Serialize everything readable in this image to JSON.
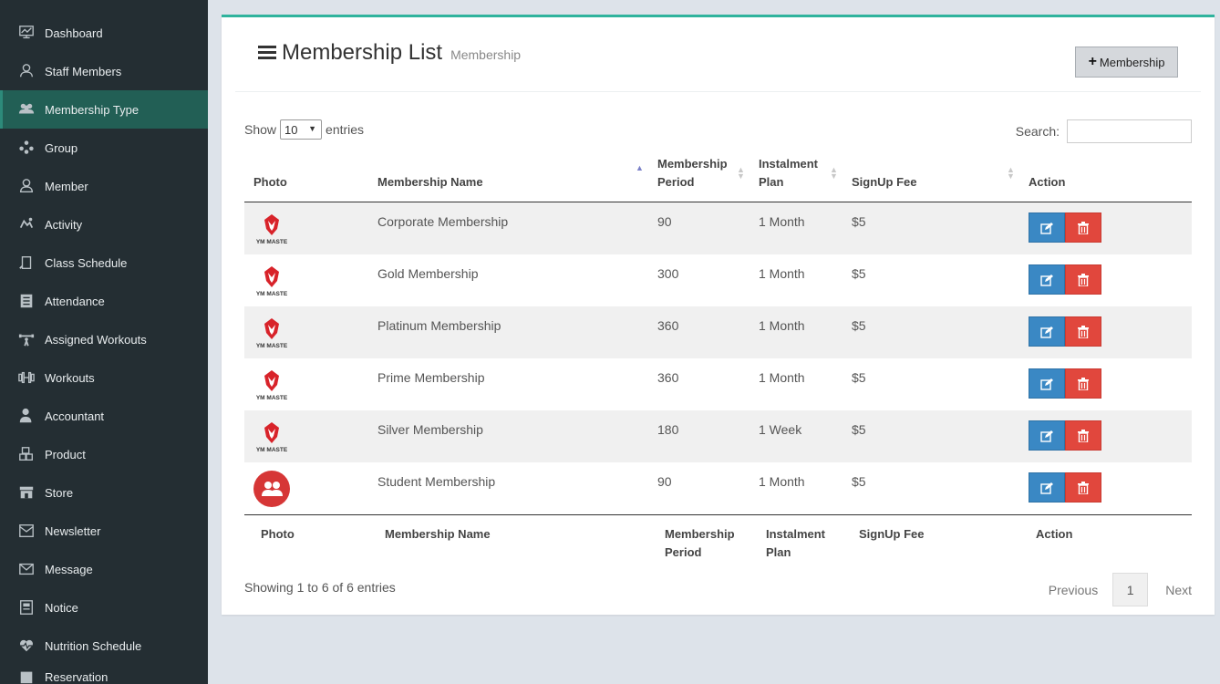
{
  "sidebar": {
    "items": [
      {
        "label": "Dashboard",
        "icon": "dashboard-icon"
      },
      {
        "label": "Staff Members",
        "icon": "staff-icon"
      },
      {
        "label": "Membership Type",
        "icon": "membership-type-icon",
        "active": true
      },
      {
        "label": "Group",
        "icon": "group-icon"
      },
      {
        "label": "Member",
        "icon": "member-icon"
      },
      {
        "label": "Activity",
        "icon": "activity-icon"
      },
      {
        "label": "Class Schedule",
        "icon": "class-schedule-icon"
      },
      {
        "label": "Attendance",
        "icon": "attendance-icon"
      },
      {
        "label": "Assigned Workouts",
        "icon": "assigned-workouts-icon"
      },
      {
        "label": "Workouts",
        "icon": "workouts-icon"
      },
      {
        "label": "Accountant",
        "icon": "accountant-icon"
      },
      {
        "label": "Product",
        "icon": "product-icon"
      },
      {
        "label": "Store",
        "icon": "store-icon"
      },
      {
        "label": "Newsletter",
        "icon": "newsletter-icon"
      },
      {
        "label": "Message",
        "icon": "message-icon"
      },
      {
        "label": "Notice",
        "icon": "notice-icon"
      },
      {
        "label": "Nutrition Schedule",
        "icon": "nutrition-icon"
      },
      {
        "label": "Reservation",
        "icon": "reservation-icon"
      }
    ],
    "icon_color": "#b9c1c6"
  },
  "header": {
    "title": "Membership List",
    "subtitle": "Membership",
    "add_button_label": "Membership"
  },
  "controls": {
    "show_label": "Show",
    "page_size": "10",
    "entries_label": "entries",
    "search_label": "Search:",
    "search_value": ""
  },
  "table": {
    "columns": [
      "Photo",
      "Membership Name",
      "Membership Period",
      "Instalment Plan",
      "SignUp Fee",
      "Action"
    ],
    "columns_wrapped": {
      "period": [
        "Membership",
        "Period"
      ],
      "plan": [
        "Instalment",
        "Plan"
      ]
    },
    "rows": [
      {
        "photo": "gym-master-logo",
        "name": "Corporate Membership",
        "period": "90",
        "plan": "1 Month",
        "fee": "$5"
      },
      {
        "photo": "gym-master-logo",
        "name": "Gold Membership",
        "period": "300",
        "plan": "1 Month",
        "fee": "$5"
      },
      {
        "photo": "gym-master-logo",
        "name": "Platinum Membership",
        "period": "360",
        "plan": "1 Month",
        "fee": "$5"
      },
      {
        "photo": "gym-master-logo",
        "name": "Prime Membership",
        "period": "360",
        "plan": "1 Month",
        "fee": "$5"
      },
      {
        "photo": "gym-master-logo",
        "name": "Silver Membership",
        "period": "180",
        "plan": "1 Week",
        "fee": "$5"
      },
      {
        "photo": "members-avatar",
        "name": "Student Membership",
        "period": "90",
        "plan": "1 Month",
        "fee": "$5"
      }
    ],
    "logo_text": "YM MASTE"
  },
  "footer": {
    "info": "Showing 1 to 6 of 6 entries",
    "prev": "Previous",
    "page": "1",
    "next": "Next"
  },
  "colors": {
    "sidebar_bg": "#242e33",
    "active_bg": "#225f55",
    "accent": "#2fb39d",
    "edit": "#3a88c4",
    "delete": "#e1473d"
  }
}
